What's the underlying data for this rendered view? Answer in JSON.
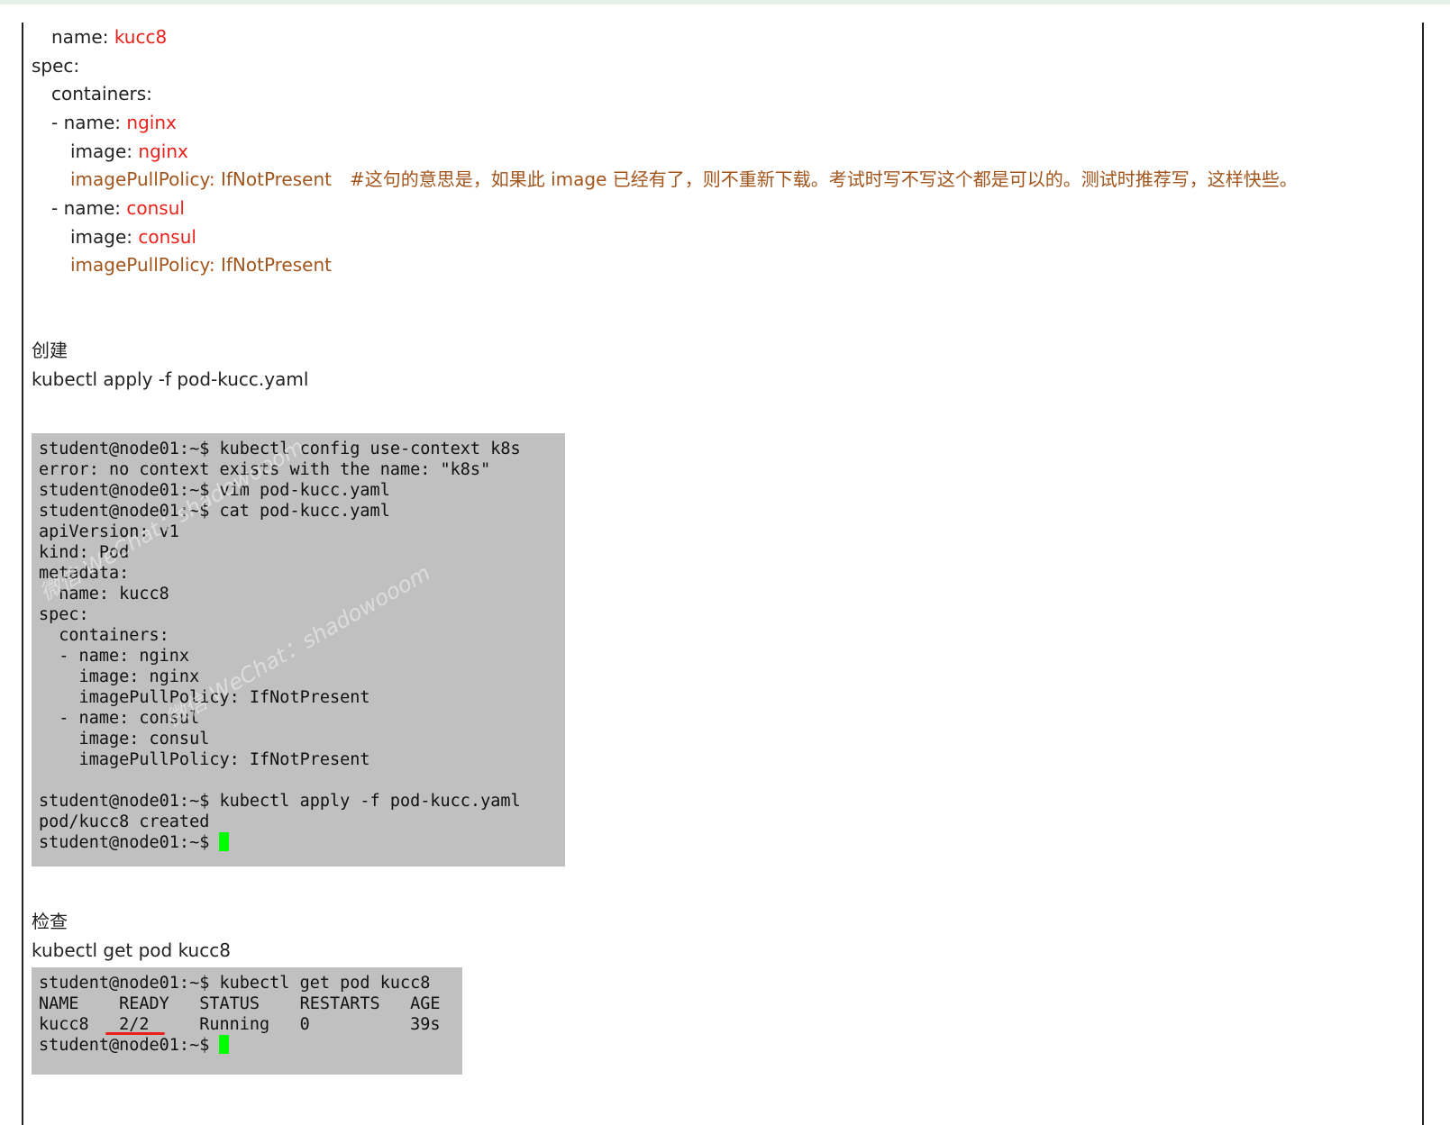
{
  "yaml": {
    "line1": {
      "key": "name: ",
      "value": "kucc8"
    },
    "line2": "spec:",
    "line3": "containers:",
    "line4": {
      "key": "- name: ",
      "value": "nginx"
    },
    "line5": {
      "key": "image: ",
      "value": "nginx"
    },
    "line6": {
      "text": "imagePullPolicy: IfNotPresent",
      "comment": "#这句的意思是，如果此 image 已经有了，则不重新下载。考试时写不写这个都是可以的。测试时推荐写，这样快些。"
    },
    "line7": {
      "key": "- name: ",
      "value": "consul"
    },
    "line8": {
      "key": "image: ",
      "value": "consul"
    },
    "line9": {
      "text": "imagePullPolicy: IfNotPresent"
    }
  },
  "section_create": {
    "heading": "创建",
    "command": "kubectl apply -f pod-kucc.yaml"
  },
  "terminal1": {
    "lines": [
      "student@node01:~$ kubectl config use-context k8s",
      "error: no context exists with the name: \"k8s\"",
      "student@node01:~$ vim pod-kucc.yaml",
      "student@node01:~$ cat pod-kucc.yaml",
      "apiVersion: v1",
      "kind: Pod",
      "metadata:",
      "  name: kucc8",
      "spec:",
      "  containers:",
      "  - name: nginx",
      "    image: nginx",
      "    imagePullPolicy: IfNotPresent",
      "  - name: consul",
      "    image: consul",
      "    imagePullPolicy: IfNotPresent",
      "",
      "student@node01:~$ kubectl apply -f pod-kucc.yaml",
      "pod/kucc8 created",
      "student@node01:~$ "
    ],
    "watermark1": "微信 WeChat：shadowooom",
    "watermark2": "微信 WeChat：shadowooom"
  },
  "section_check": {
    "heading": "检查",
    "command": "kubectl get pod kucc8"
  },
  "terminal2": {
    "lines": [
      "student@node01:~$ kubectl get pod kucc8",
      "NAME    READY   STATUS    RESTARTS   AGE",
      "kucc8   2/2     Running   0          39s",
      "student@node01:~$ "
    ]
  },
  "colors": {
    "value_red": "#e8221b",
    "comment_brown": "#a2551c",
    "terminal_bg": "#c0c0c0",
    "cursor_green": "#00ff00"
  }
}
